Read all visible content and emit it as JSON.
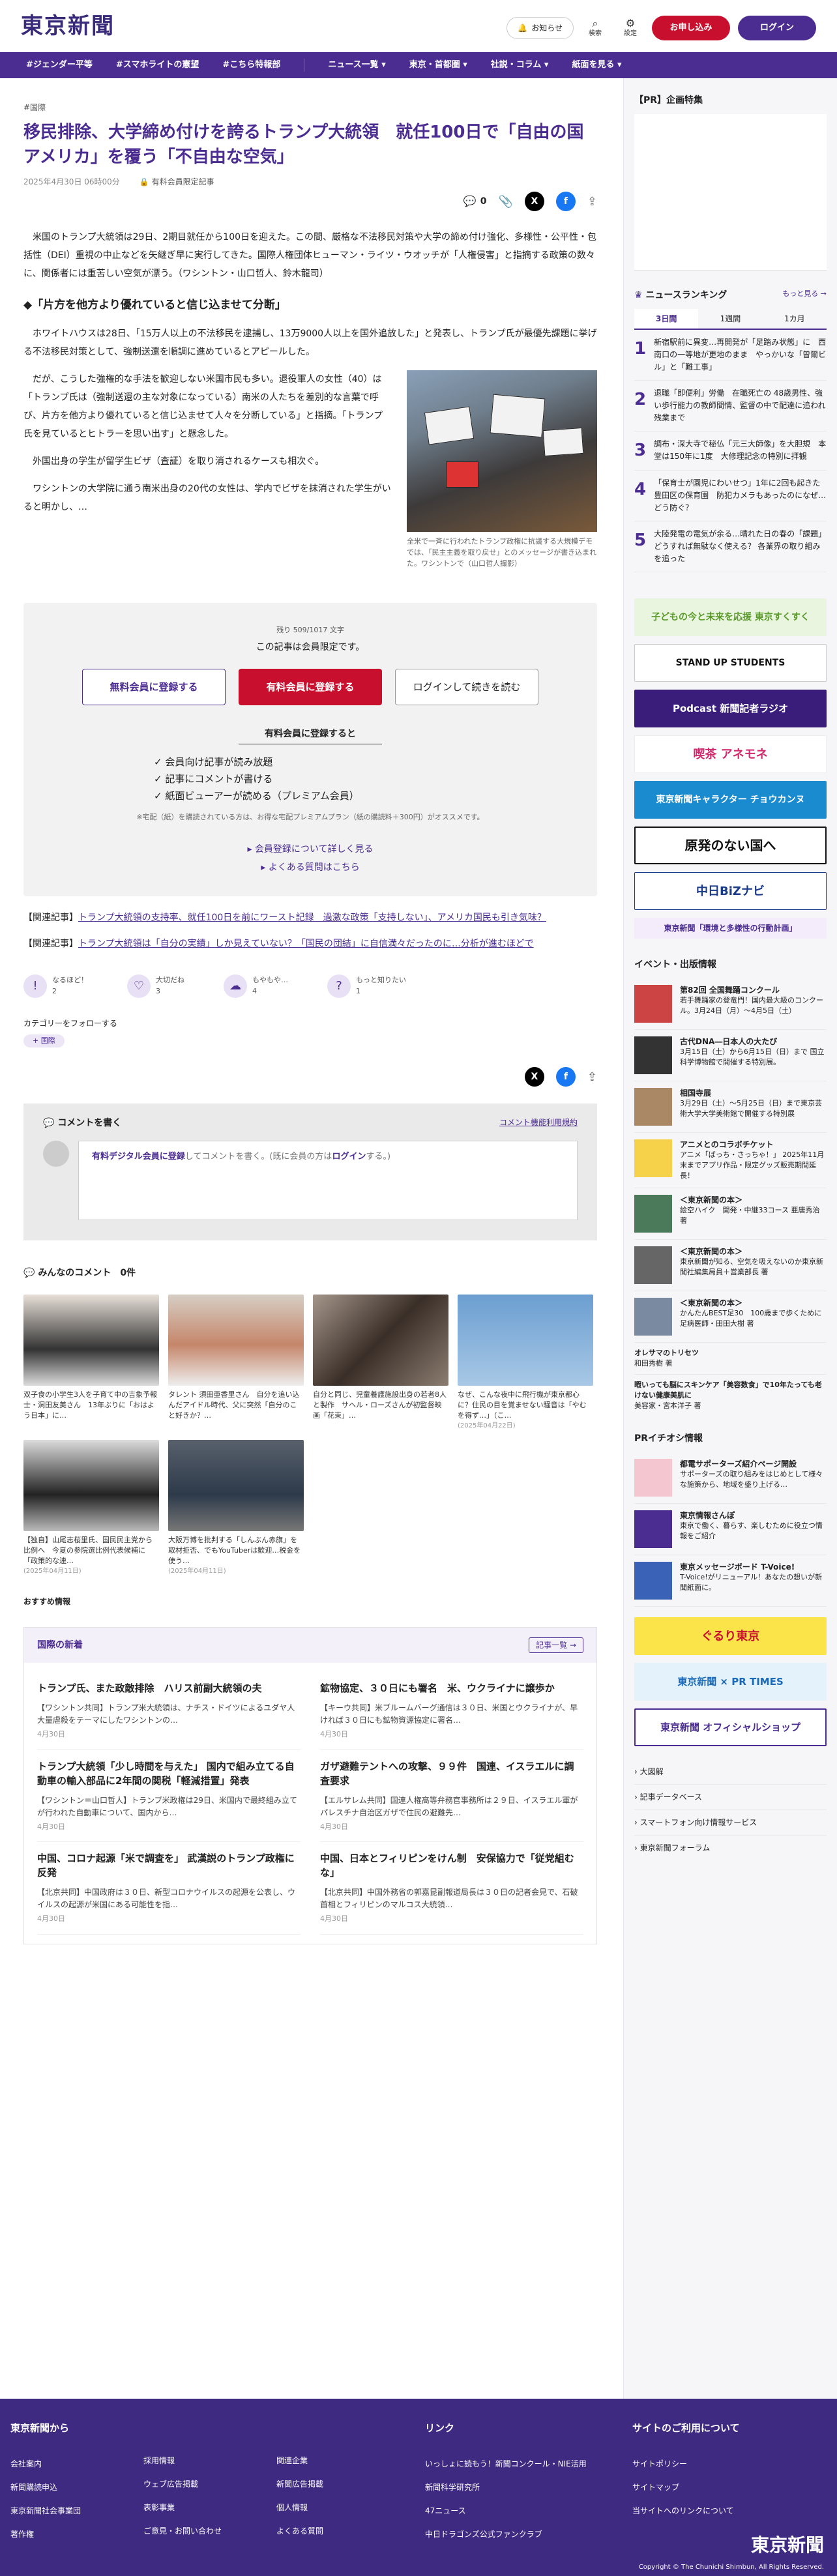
{
  "header": {
    "logo": "東京新聞",
    "notice": "お知らせ",
    "search": "検索",
    "settings": "設定",
    "apply": "お申し込み",
    "login": "ログイン"
  },
  "nav": [
    "#ジェンダー平等",
    "#スマホライトの憲望",
    "#こちら特報部",
    "ニュース一覧 ▾",
    "東京・首都圏 ▾",
    "社説・コラム ▾",
    "紙面を見る ▾"
  ],
  "article": {
    "tag": "#国際",
    "title": "移民排除、大学締め付けを誇るトランプ大統領　就任100日で「自由の国アメリカ」を覆う「不自由な空気」",
    "date": "2025年4月30日 06時00分",
    "member_label": "有料会員限定記事",
    "comment_count": "0",
    "p1": "　米国のトランプ大統領は29日、2期目就任から100日を迎えた。この間、厳格な不法移民対策や大学の締め付け強化、多様性・公平性・包括性（DEI）重視の中止などを矢継ぎ早に実行してきた。国際人権団体ヒューマン・ライツ・ウオッチが「人権侵害」と指摘する政策の数々に、関係者には重苦しい空気が漂う。（ワシントン・山口哲人、鈴木龍司）",
    "h2": "◆「片方を他方より優れていると信じ込ませて分断」",
    "p2": "　ホワイトハウスは28日、「15万人以上の不法移民を逮捕し、13万9000人以上を国外追放した」と発表し、トランプ氏が最優先課題に挙げる不法移民対策として、強制送還を順調に進めているとアピールした。",
    "p3": "　だが、こうした強権的な手法を歓迎しない米国市民も多い。退役軍人の女性（40）は「トランプ氏は（強制送還の主な対象になっている）南米の人たちを差別的な言葉で呼び、片方を他方より優れていると信じ込ませて人々を分断している」と指摘。「トランプ氏を見ているとヒトラーを思い出す」と懸念した。",
    "p4": "　外国出身の学生が留学生ビザ（査証）を取り消されるケースも相次ぐ。",
    "p5": "　ワシントンの大学院に通う南米出身の20代の女性は、学内でビザを抹消された学生がいると明かし、…",
    "caption": "全米で一斉に行われたトランプ政権に抗議する大規模デモでは、「民主主義を取り戻せ」とのメッセージが書き込まれた。ワシントンで（山口哲人撮影）"
  },
  "paywall": {
    "remaining": "残り 509/1017 文字",
    "lead": "この記事は会員限定です。",
    "free_btn": "無料会員に登録する",
    "paid_btn": "有料会員に登録する",
    "login_btn": "ログインして続きを読む",
    "benefits_title": "有料会員に登録すると",
    "benefits": [
      "会員向け記事が読み放題",
      "記事にコメントが書ける",
      "紙面ビューアーが読める（プレミアム会員）"
    ],
    "note": "※宅配（紙）を購読されている方は、お得な宅配プレミアムプラン（紙の購読料＋300円）がオススメです。",
    "link1": "会員登録について詳しく見る",
    "link2": "よくある質問はこちら"
  },
  "related": [
    {
      "label": "【関連記事】",
      "text": "トランプ大統領の支持率、就任100日を前にワースト記録　過激な政策「支持しない」、アメリカ国民も引き気味？"
    },
    {
      "label": "【関連記事】",
      "text": "トランプ大統領は「自分の実績」しか見えていない？「国民の団結」に自信満々だったのに…分析が進むほどで"
    }
  ],
  "reactions": [
    {
      "label": "なるほど！",
      "count": "2"
    },
    {
      "label": "大切だね",
      "count": "3"
    },
    {
      "label": "もやもや…",
      "count": "4"
    },
    {
      "label": "もっと知りたい",
      "count": "1"
    }
  ],
  "follow": {
    "label": "カテゴリーをフォローする",
    "tag": "国際"
  },
  "comment": {
    "title": "コメントを書く",
    "rules": "コメント機能利用規約",
    "prompt_link": "有料デジタル会員に登録",
    "prompt_rest": "してコメントを書く。(既に会員の方は",
    "prompt_login": "ログイン",
    "prompt_end": "する。)",
    "list_title": "みんなのコメント",
    "list_count": "0件"
  },
  "cards": [
    {
      "t": "双子食の小学生3人を子育て中の吉象予報士・洞田友美さん　13年ぶりに「おはよう日本」に…",
      "d": ""
    },
    {
      "t": "タレント 須田亜香里さん　自分を追い込んだアイドル時代、父に突然「自分のこと好きか？…",
      "d": ""
    },
    {
      "t": "自分と同じ、児童養護施設出身の若者8人と製作　サヘル・ローズさんが初監督映画「花束」…",
      "d": ""
    },
    {
      "t": "なぜ、こんな夜中に飛行機が東京都心に？住民の目を覚ませない騒音は「やむを得ず…」（こ…",
      "d": "(2025年04月22日)"
    },
    {
      "t": "【独自】山尾志桜里氏、国民民主党から比例へ　今夏の参院選比例代表候補に「政策的な連…",
      "d": "(2025年04月11日)"
    },
    {
      "t": "大阪万博を批判する「しんぶん赤旗」を取材拒否、でもYouTuberは歓迎…税金を使う…",
      "d": "(2025年04月11日)"
    }
  ],
  "recommend": "おすすめ情報",
  "news": {
    "title": "国際の新着",
    "more": "記事一覧 →",
    "items": [
      {
        "h": "トランプ氏、また政敵排除　ハリス前副大統領の夫",
        "p": "【ワシントン共同】トランプ米大統領は、ナチス・ドイツによるユダヤ人大量虐殺をテーマにしたワシントンの…",
        "d": "4月30日"
      },
      {
        "h": "鉱物協定、３０日にも署名　米、ウクライナに譲歩か",
        "p": "【キーウ共同】米ブルームバーグ通信は３０日、米国とウクライナが、早ければ３０日にも鉱物資源協定に署名…",
        "d": "4月30日"
      },
      {
        "h": "トランプ大統領「少し時間を与えた」 国内で組み立てる自動車の輸入部品に2年間の関税「軽減措置」発表",
        "p": "【ワシントン＝山口哲人】トランプ米政権は29日、米国内で最終組み立てが行われた自動車について、国内から…",
        "d": "4月30日"
      },
      {
        "h": "ガザ避難テントへの攻撃、９９件　国連、イスラエルに調査要求",
        "p": "【エルサレム共同】国連人権高等弁務官事務所は２９日、イスラエル軍がパレスチナ自治区ガザで住民の避難先…",
        "d": "4月30日"
      },
      {
        "h": "中国、コロナ起源「米で調査を」 武漢説のトランプ政権に反発",
        "p": "【北京共同】中国政府は３０日、新型コロナウイルスの起源を公表し、ウイルスの起源が米国にある可能性を指…",
        "d": "4月30日"
      },
      {
        "h": "中国、日本とフィリピンをけん制　安保協力で「従党組むな」",
        "p": "【北京共同】中国外務省の郭嘉昆副報道局長は３０日の記者会見で、石破首相とフィリピンのマルコス大統領…",
        "d": "4月30日"
      }
    ]
  },
  "side": {
    "pr": "【PR】企画特集",
    "ranking_title": "ニュースランキング",
    "ranking_more": "もっと見る →",
    "tabs": [
      "3日間",
      "1週間",
      "1カ月"
    ],
    "ranking": [
      "新宿駅前に異変…再開発が「足踏み状態」に　西南口の一等地が更地のまま　やっかいな「曽爾ビル」と「難工事」",
      "退職「即便利」労働　在職死亡の 48歳男性、強い歩行能力の教師間情、監督の中で配達に追われ残業まで",
      "調布・深大寺で秘仏「元三大師像」を大胆規　本堂は150年に1度　大修理記念の特別に拝観",
      "「保育士が園児にわいせつ」1年に2回も起きた豊田区の保育園　防犯カメラもあったのになぜ…どう防ぐ？",
      "大陸発電の電気が余る…晴れた日の春の「課題」 どうすれば無駄なく使える？ 各業界の取り組みを追った"
    ],
    "banners": [
      "子どもの今と未来を応援 東京すくすく",
      "STAND UP STUDENTS",
      "Podcast 新聞記者ラジオ",
      "喫茶 アネモネ",
      "東京新聞キャラクター チョウカンヌ",
      "原発のない国へ",
      "中日BiZナビ",
      "東京新聞「環境と多様性の行動計画」"
    ],
    "events_title": "イベント・出版情報",
    "events": [
      {
        "b": "第82回 全国舞踊コンクール",
        "t": "若手舞踊家の登竜門！国内最大級のコンクール。3月24日（月）〜4月5日（土）"
      },
      {
        "b": "古代DNA―日本人の大たび",
        "t": "3月15日（土）から6月15日（日）まで 国立科学博物館で開催する特別展。"
      },
      {
        "b": "相国寺展",
        "t": "3月29日（土）〜5月25日（日）まで東京芸術大学大学美術館で開催する特別展"
      },
      {
        "b": "アニメとのコラボチケット",
        "t": "アニメ「ばっち・さっちゃ！」 2025年11月末までアプリ作品・限定グッズ販売期間延長！"
      },
      {
        "b": "＜東京新聞の本＞",
        "t": "絵空ハイク　開発・中継33コース 亜唐秀治 著"
      },
      {
        "b": "＜東京新聞の本＞",
        "t": "東京新聞が知る、空気を吸えないのか東京新聞社編集局員＋営業部長 著"
      },
      {
        "b": "＜東京新聞の本＞",
        "t": "かんたんBEST足30　100歳まで歩くために 足病医師・田田大樹 著"
      }
    ],
    "extra": [
      {
        "b": "オレサマのトリセツ",
        "t": "和田秀樹 著"
      },
      {
        "b": "暇いっても脳にスキンケア「美容数食」で10年たっても老けない健康美肌に",
        "t": "美容家・宮本洋子 著"
      }
    ],
    "pr2": "PRイチオシ情報",
    "pr_items": [
      {
        "b": "都電サポーターズ紹介ページ開設",
        "t": "サポーターズの取り組みをはじめとして様々な施策から、地域を盛り上げる…"
      },
      {
        "b": "東京情報さんぽ",
        "t": "東京で働く、暮らす、楽しむために役立つ情報をご紹介"
      },
      {
        "b": "東京メッセージボード T-Voice!",
        "t": "T-Voice!がリニューアル！あなたの想いが新聞紙面に。"
      }
    ],
    "banners2": [
      "ぐるり東京",
      "東京新聞 × PR TIMES",
      "東京新聞 オフィシャルショップ"
    ],
    "links": [
      "大図解",
      "記事データベース",
      "スマートフォン向け情報サービス",
      "東京新聞フォーラム"
    ]
  },
  "footer": {
    "from": "東京新聞から",
    "col1": [
      "会社案内",
      "新聞購読申込",
      "東京新聞社会事業団",
      "著作権"
    ],
    "col2": [
      "採用情報",
      "ウェブ広告掲載",
      "表彰事業",
      "ご意見・お問い合わせ"
    ],
    "col3": [
      "関連企業",
      "新聞広告掲載",
      "個人情報",
      "よくある質問"
    ],
    "links_title": "リンク",
    "col4": [
      "いっしょに読もう！新聞コンクール・NIE活用",
      "新聞科学研究所",
      "47ニュース",
      "中日ドラゴンズ公式ファンクラブ"
    ],
    "use_title": "サイトのご利用について",
    "col5": [
      "サイトポリシー",
      "サイトマップ",
      "当サイトへのリンクについて"
    ],
    "logo": "東京新聞",
    "copy": "Copyright © The Chunichi Shimbun, All Rights Reserved."
  },
  "colors": {
    "brand": "#4b2c91",
    "red": "#c8102e"
  }
}
